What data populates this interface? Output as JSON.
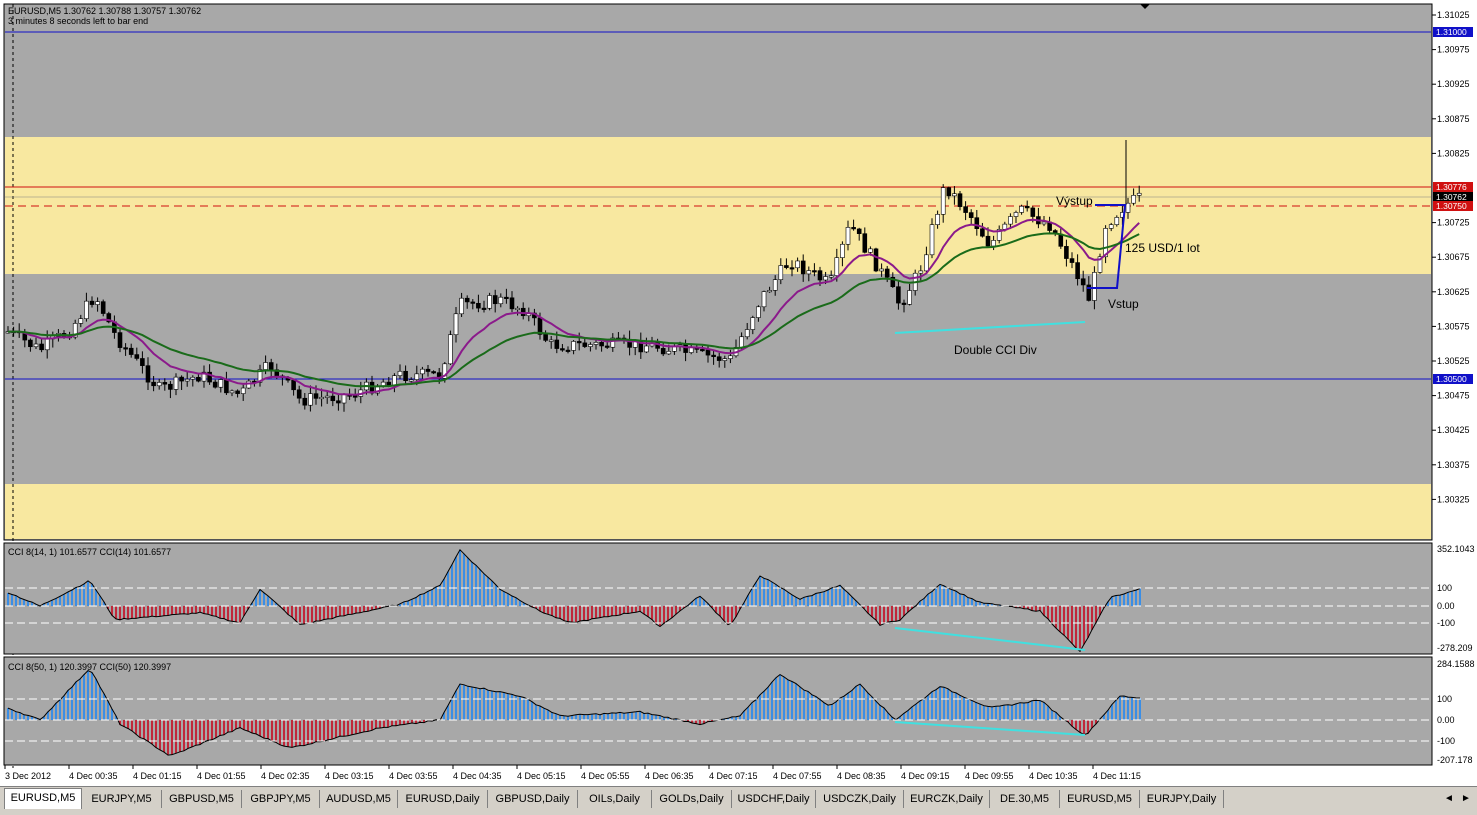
{
  "main": {
    "header": "EURUSD,M5  1.30762 1.30788 1.30757 1.30762",
    "bar_info": "3 minutes 8 seconds left to bar end",
    "price_labels": [
      "1.31025",
      "1.30975",
      "1.30925",
      "1.30875",
      "1.30825",
      "1.30725",
      "1.30675",
      "1.30625",
      "1.30575",
      "1.30525",
      "1.30475",
      "1.30425",
      "1.30375",
      "1.30325"
    ],
    "line_labels": {
      "top": "1.31000",
      "upper_red": "1.30776",
      "current": "1.30762",
      "dashed_red": "1.30750",
      "bottom": "1.30500"
    },
    "annotations": {
      "vystup": "Výstup",
      "profit": "125 USD/1 lot",
      "vstup": "Vstup",
      "div": "Double CCI Div"
    }
  },
  "cci1": {
    "header": "CCI 8(14, 1) 101.6577  CCI(14) 101.6577",
    "labels": [
      "352.1043",
      "100",
      "0.00",
      "-100",
      "-278.209"
    ]
  },
  "cci2": {
    "header": "CCI 8(50, 1) 120.3997  CCI(50) 120.3997",
    "labels": [
      "284.1588",
      "100",
      "0.00",
      "-100",
      "-207.178"
    ]
  },
  "time_labels": [
    "3 Dec 2012",
    "4 Dec 00:35",
    "4 Dec 01:15",
    "4 Dec 01:55",
    "4 Dec 02:35",
    "4 Dec 03:15",
    "4 Dec 03:55",
    "4 Dec 04:35",
    "4 Dec 05:15",
    "4 Dec 05:55",
    "4 Dec 06:35",
    "4 Dec 07:15",
    "4 Dec 07:55",
    "4 Dec 08:35",
    "4 Dec 09:15",
    "4 Dec 09:55",
    "4 Dec 10:35",
    "4 Dec 11:15"
  ],
  "tabs": [
    "EURUSD,M5",
    "EURJPY,M5",
    "GBPUSD,M5",
    "GBPJPY,M5",
    "AUDUSD,M5",
    "EURUSD,Daily",
    "GBPUSD,Daily",
    "OILs,Daily",
    "GOLDs,Daily",
    "USDCHF,Daily",
    "USDCZK,Daily",
    "EURCZK,Daily",
    "DE.30,M5",
    "EURUSD,M5",
    "EURJPY,Daily"
  ],
  "nav": {
    "left": "◄",
    "right": "►"
  },
  "colors": {
    "panel_bg": "#a8a8a8",
    "zone": "#f8e8a0",
    "bull": "#ffffff",
    "bear": "#000000",
    "ma_fast": "#8b1a8b",
    "ma_slow": "#1a6b1a",
    "div_line": "#40e0e0",
    "cci_pos": "#3a8ee6",
    "cci_neg": "#c0283a",
    "level_blue": "#1010c8",
    "level_red": "#d01010"
  }
}
